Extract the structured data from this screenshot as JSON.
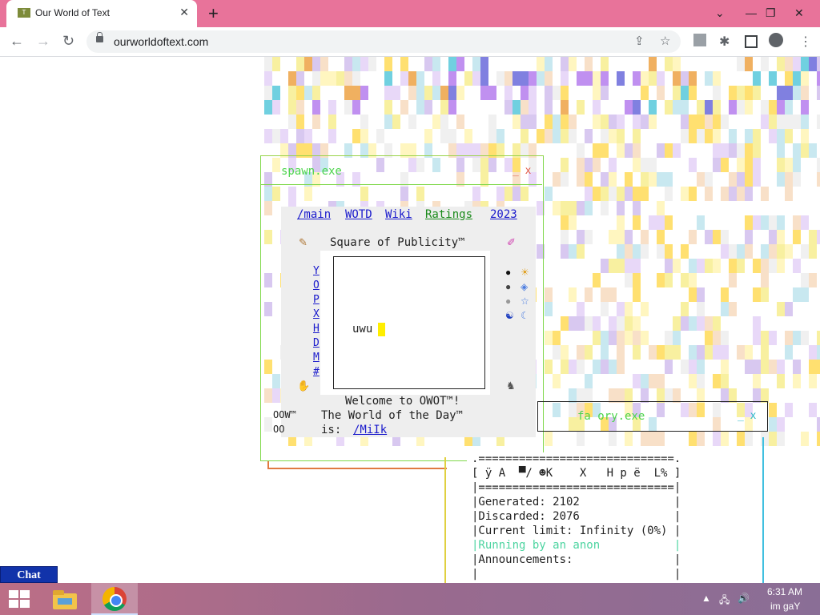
{
  "browser": {
    "tab_title": "Our World of Text",
    "favicon_text": "T",
    "url": "ourworldoftext.com"
  },
  "spawn_window": {
    "title": "spawn.exe",
    "controls": "_ x"
  },
  "menu": {
    "links": [
      "/main",
      "WOTD",
      "Wiki",
      "Ratings",
      "2023"
    ],
    "link_colors": [
      "#1a1acc",
      "#1a1acc",
      "#1a1acc",
      "#1a8a1a",
      "#1a1acc"
    ]
  },
  "square": {
    "title": "Square of Publicity™",
    "text": "uwu",
    "letters": [
      "Y",
      "O",
      "P",
      "X",
      "H",
      "D",
      "M",
      "#"
    ]
  },
  "welcome": {
    "line1": "Welcome to OWOT™!",
    "line2": "The World of the Day™",
    "is_label": "is:",
    "wotd_link": "/MiIk",
    "left1": "OOW™",
    "left2": "OO"
  },
  "factory_window": {
    "title": "fa  ory.exe",
    "controls": "_ x",
    "rule_top": ".=============================.",
    "header": "[ ÿ A  ▀/ ☻K    X   H p ë  L% ]",
    "rule_mid": "|=============================|",
    "generated": "|Generated: 2102              |",
    "discarded": "|Discarded: 2076              |",
    "limit": "|Current limit: Infinity (0%) |",
    "running": "|Running by an anon           |",
    "announcements": "|Announcements:               |",
    "blank": "|                             |"
  },
  "chat": {
    "label": "Chat"
  },
  "taskbar": {
    "time": "6:31 AM",
    "date": "im gaY"
  }
}
